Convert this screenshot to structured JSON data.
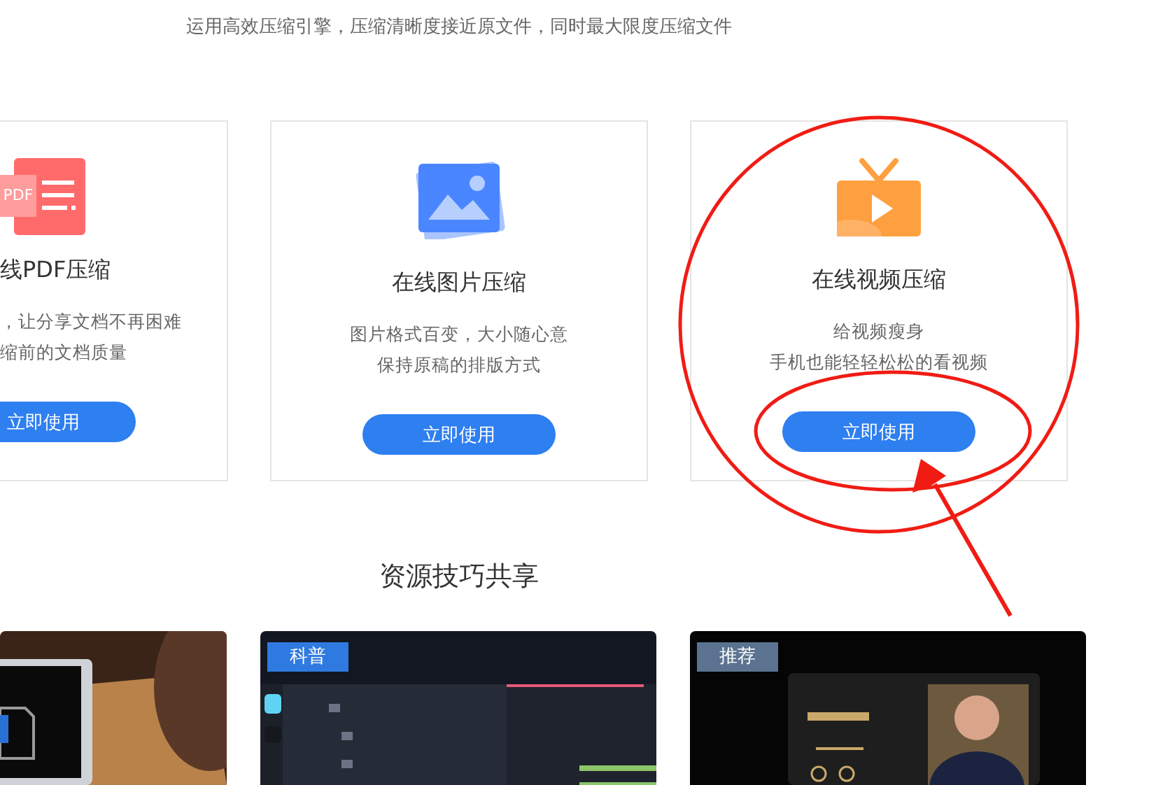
{
  "tagline": "运用高效压缩引擎，压缩清晰度接近原文件，同时最大限度压缩文件",
  "tools": [
    {
      "kind": "clipped",
      "icon_text": "PDF",
      "title": "线PDF压缩",
      "lines": [
        "，让分享文档不再困难",
        "缩前的文档质量"
      ],
      "button": "立即使用"
    },
    {
      "kind": "card",
      "title": "在线图片压缩",
      "lines": [
        "图片格式百变，大小随心意",
        "保持原稿的排版方式"
      ],
      "button": "立即使用"
    },
    {
      "kind": "card",
      "title": "在线视频压缩",
      "lines": [
        "给视频瘦身",
        "手机也能轻轻松松的看视频"
      ],
      "button": "立即使用"
    }
  ],
  "section_title": "资源技巧共享",
  "articles": [
    {
      "kind": "picture"
    },
    {
      "kind": "picture",
      "tag": "科普",
      "color": "#2f7ae0"
    },
    {
      "kind": "picture",
      "tag": "推荐",
      "color": "#5b7391"
    }
  ],
  "annotations": [
    {
      "kind": "circle"
    },
    {
      "kind": "ellipse"
    },
    {
      "kind": "arrow"
    }
  ]
}
